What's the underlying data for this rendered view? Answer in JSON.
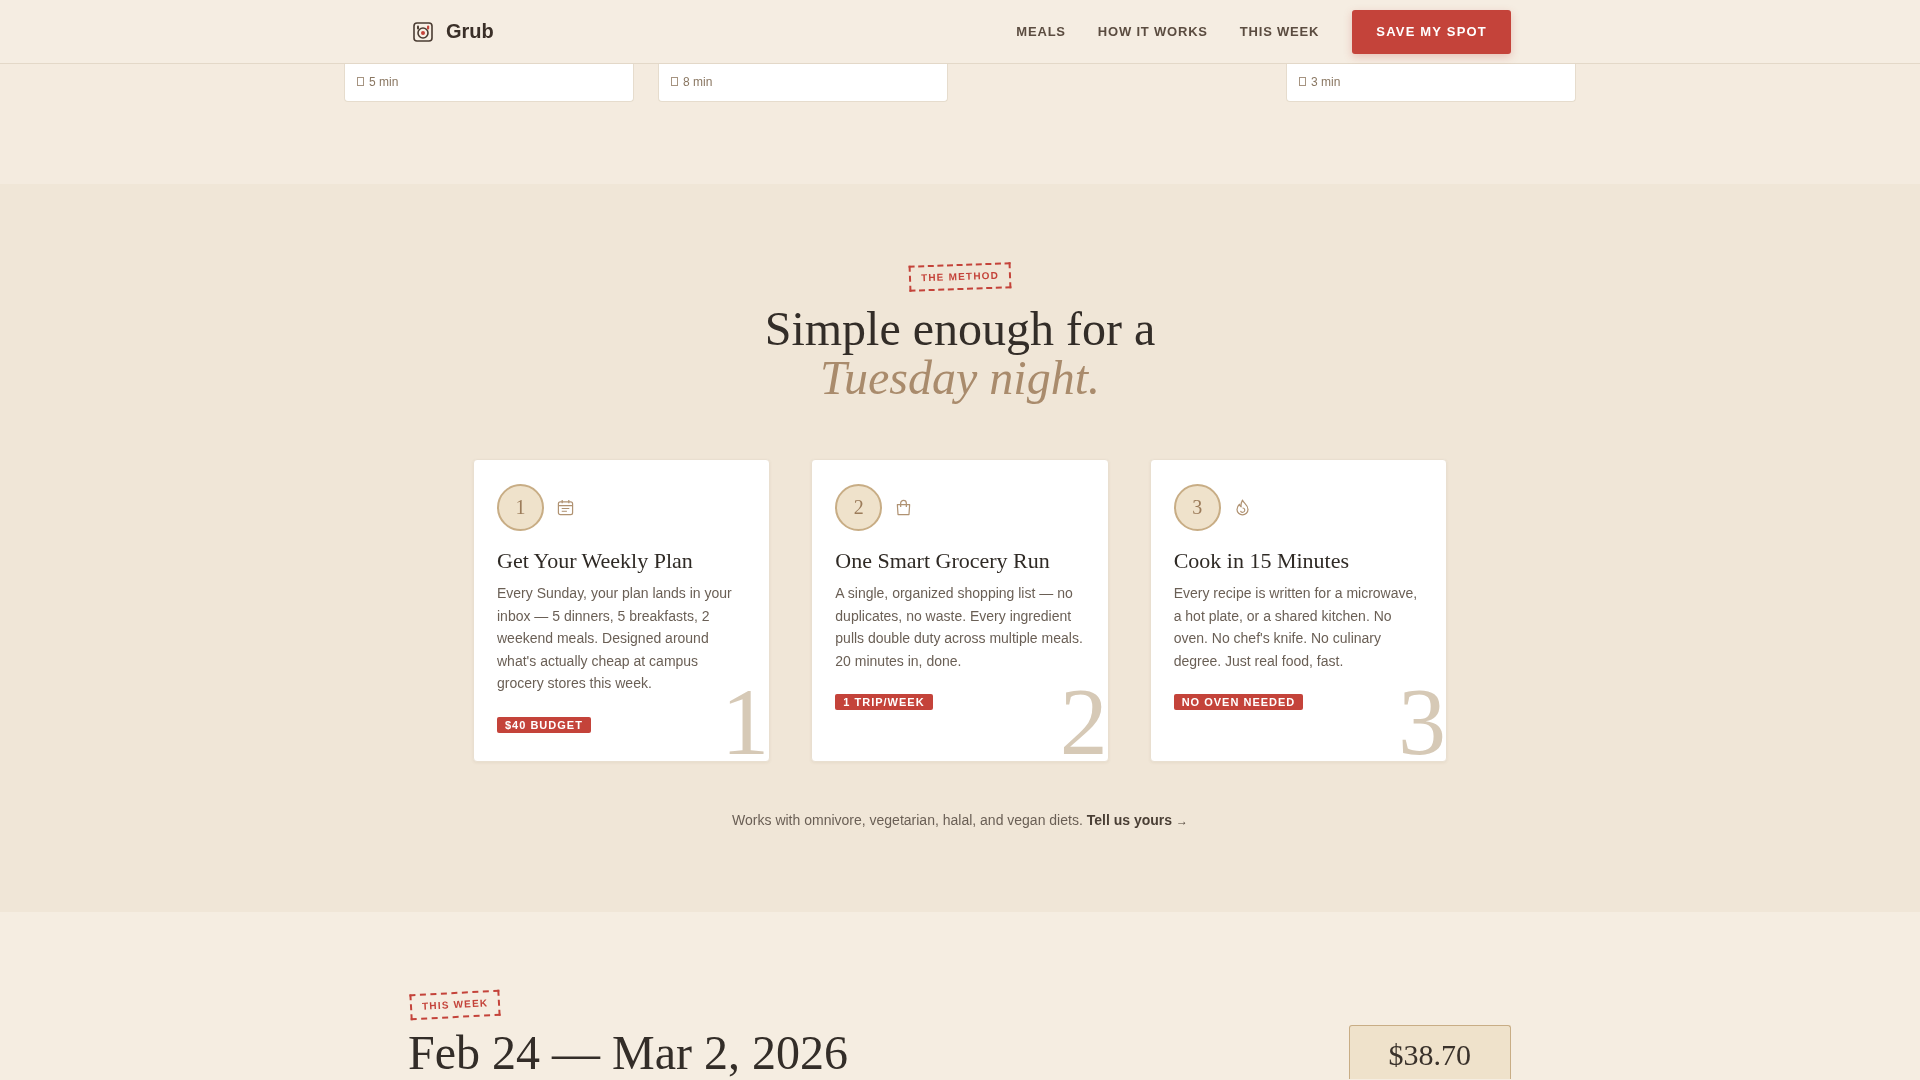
{
  "header": {
    "brand": "Grub",
    "nav": [
      {
        "label": "MEALS"
      },
      {
        "label": "HOW IT WORKS"
      },
      {
        "label": "THIS WEEK"
      }
    ],
    "cta": "SAVE MY SPOT"
  },
  "recipe_cards": [
    {
      "time": "5 min"
    },
    {
      "time": "8 min"
    },
    {
      "time": "3 min"
    }
  ],
  "method": {
    "stamp": "THE METHOD",
    "heading": "Simple enough for a *Tuesday night.*",
    "steps": [
      {
        "number": "1",
        "title": "Get Your Weekly Plan",
        "body": "Every Sunday, your plan lands in your inbox — 5 dinners, 5 breakfasts, 2 weekend meals. Designed around what's actually cheap at campus grocery stores this week.",
        "tag": "$40 BUDGET",
        "watermark": "1"
      },
      {
        "number": "2",
        "title": "One Smart Grocery Run",
        "body": "A single, organized shopping list — no duplicates, no waste. Every ingredient pulls double duty across multiple meals. 20 minutes in, done.",
        "tag": "1 TRIP/WEEK",
        "watermark": "2"
      },
      {
        "number": "3",
        "title": "Cook in 15 Minutes",
        "body": "Every recipe is written for a microwave, a hot plate, or a shared kitchen. No oven. No chef's knife. No culinary degree. Just real food, fast.",
        "tag": "NO OVEN NEEDED",
        "watermark": "3"
      }
    ],
    "note": "Works with omnivore, vegetarian, halal, and vegan diets.",
    "note_link": {
      "label": "Tell us yours",
      "arrow": "→"
    }
  },
  "this_week": {
    "stamp": "THIS WEEK",
    "date_range": "Feb 24 — Mar 2, 2026",
    "total": "$38.70"
  }
}
